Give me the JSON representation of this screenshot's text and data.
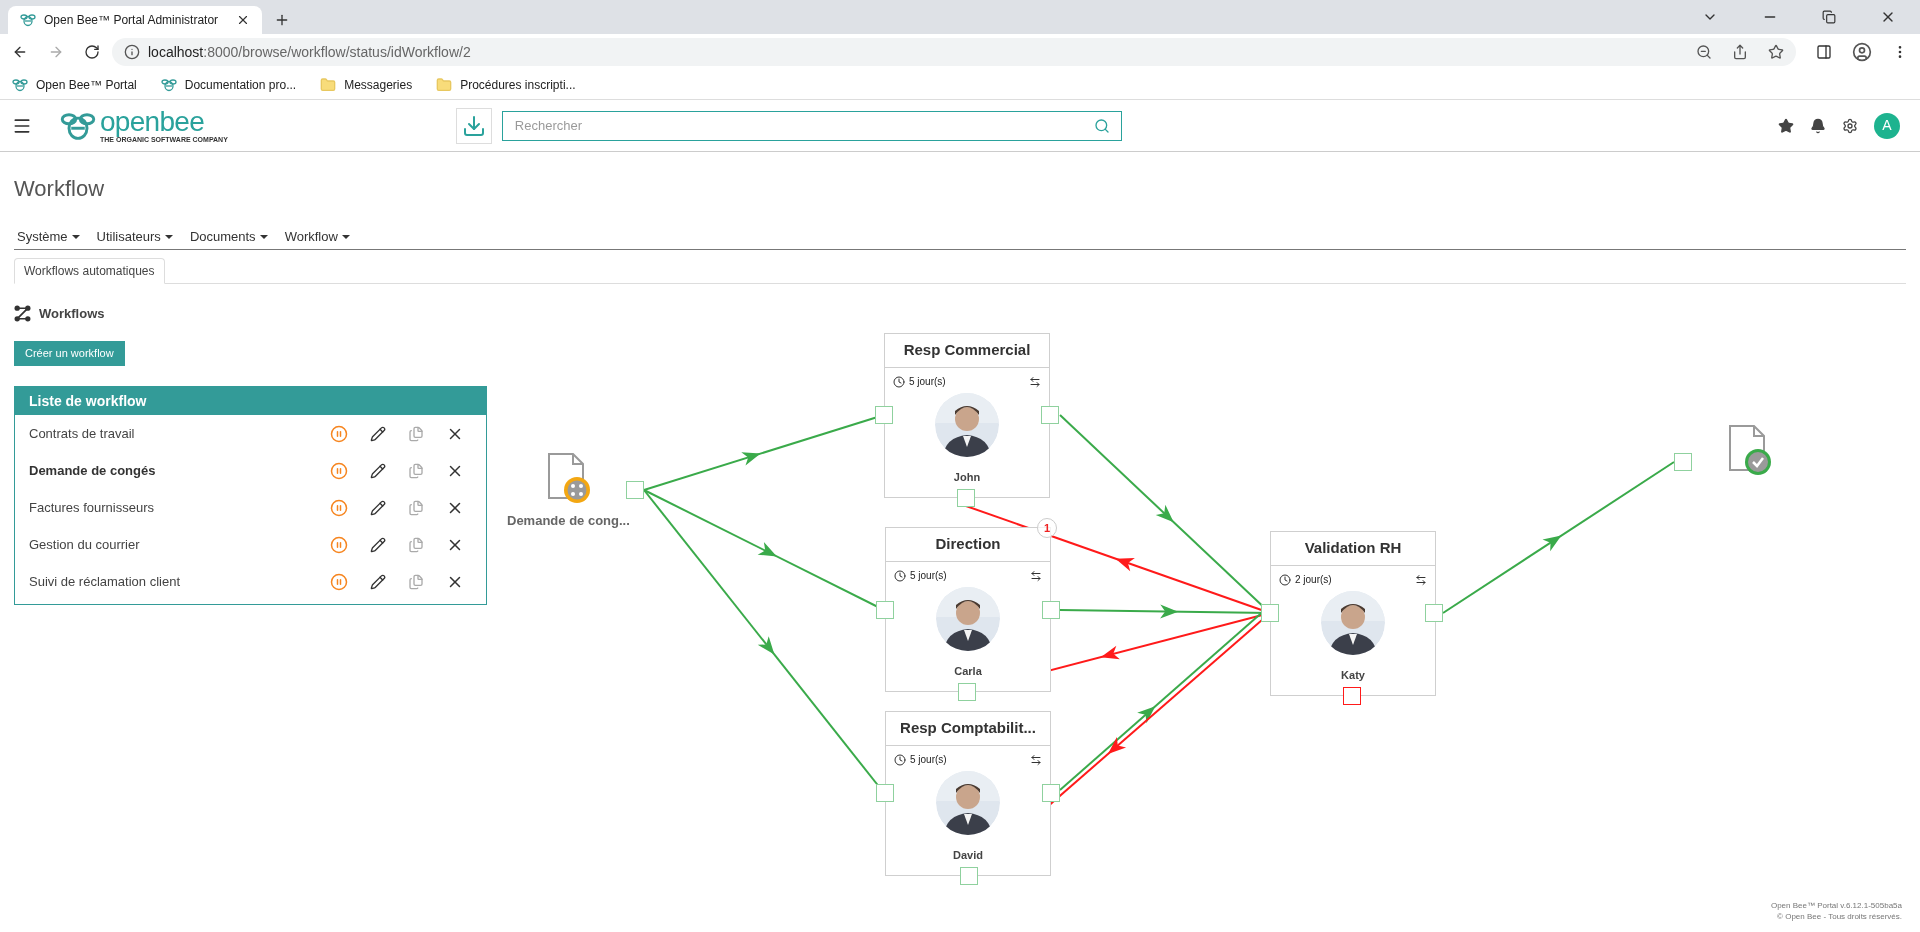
{
  "browser": {
    "tab_title": "Open Bee™ Portal Administrator",
    "url_host": "localhost",
    "url_path": ":8000/browse/workflow/status/idWorkflow/2",
    "bookmarks": [
      {
        "label": "Open Bee™ Portal",
        "kind": "site"
      },
      {
        "label": "Documentation pro...",
        "kind": "site"
      },
      {
        "label": "Messageries",
        "kind": "folder"
      },
      {
        "label": "Procédures inscripti...",
        "kind": "folder"
      }
    ]
  },
  "header": {
    "logo_text": "openbee",
    "logo_tagline": "THE ORGANIC SOFTWARE COMPANY",
    "search_placeholder": "Rechercher",
    "avatar_letter": "A"
  },
  "page_title": "Workflow",
  "menu": [
    "Système",
    "Utilisateurs",
    "Documents",
    "Workflow"
  ],
  "tabs": [
    {
      "label": "Workflows automatiques",
      "selected": true
    }
  ],
  "section_title": "Workflows",
  "create_button": "Créer un workflow",
  "workflow_list": {
    "title": "Liste de workflow",
    "items": [
      {
        "name": "Contrats de travail",
        "selected": false
      },
      {
        "name": "Demande de congés",
        "selected": true
      },
      {
        "name": "Factures fournisseurs",
        "selected": false
      },
      {
        "name": "Gestion du courrier",
        "selected": false
      },
      {
        "name": "Suivi de réclamation client",
        "selected": false
      }
    ]
  },
  "diagram": {
    "start": {
      "label": "Demande de cong..."
    },
    "steps": [
      {
        "title": "Resp Commercial",
        "delay": "5 jour(s)",
        "assignee": "John"
      },
      {
        "title": "Direction",
        "delay": "5 jour(s)",
        "assignee": "Carla"
      },
      {
        "title": "Resp Comptabilit...",
        "delay": "5 jour(s)",
        "assignee": "David"
      },
      {
        "title": "Validation RH",
        "delay": "2 jour(s)",
        "assignee": "Katy"
      }
    ],
    "badge": "1",
    "connections": [
      {
        "kind": "approve"
      },
      {
        "kind": "approve"
      },
      {
        "kind": "approve"
      },
      {
        "kind": "approve"
      },
      {
        "kind": "reject"
      },
      {
        "kind": "approve"
      },
      {
        "kind": "reject"
      },
      {
        "kind": "approve"
      },
      {
        "kind": "reject"
      },
      {
        "kind": "approve"
      }
    ]
  },
  "footer": [
    "Open Bee™ Portal v.6.12.1-505ba5a",
    "© Open Bee - Tous droits réservés."
  ]
}
